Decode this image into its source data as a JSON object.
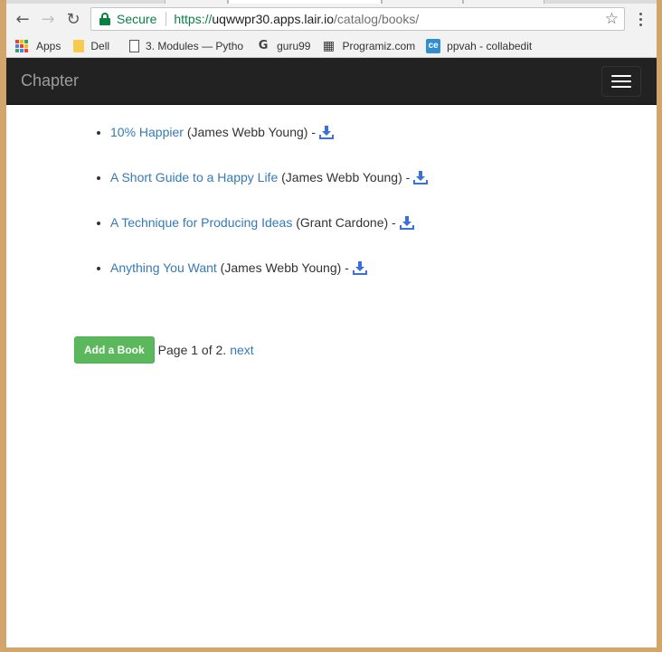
{
  "browser": {
    "address": {
      "secure_label": "Secure",
      "url_scheme": "https://",
      "url_host": "uqwwpr30.apps.lair.io",
      "url_path": "/catalog/books/"
    },
    "bookmarks": [
      {
        "label": "Apps",
        "icon": "apps-grid-icon"
      },
      {
        "label": "Dell",
        "icon": "folder-icon"
      },
      {
        "label": "3. Modules — Pytho",
        "icon": "document-icon"
      },
      {
        "label": "guru99",
        "icon": "guru99-icon"
      },
      {
        "label": "Programiz.com",
        "icon": "programiz-icon"
      },
      {
        "label": "ppvah - collabedit",
        "icon": "collabedit-icon"
      }
    ]
  },
  "navbar": {
    "brand": "Chapter"
  },
  "books": [
    {
      "title": "10% Happier",
      "author": " (James Webb Young) - "
    },
    {
      "title": "A Short Guide to a Happy Life",
      "author": " (James Webb Young) - "
    },
    {
      "title": "A Technique for Producing Ideas",
      "author": " (Grant Cardone) - "
    },
    {
      "title": "Anything You Want",
      "author": " (James Webb Young) - "
    }
  ],
  "pager": {
    "add_button": "Add a Book",
    "page_text": "Page 1 of 2.",
    "next_label": "next"
  },
  "colors": {
    "link": "#337ab7",
    "download_icon": "#3b6fd9",
    "add_button": "#5cb85c",
    "navbar": "#222222"
  }
}
